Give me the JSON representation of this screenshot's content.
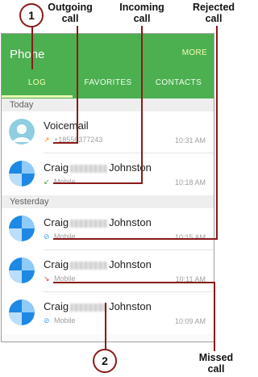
{
  "callouts": {
    "outgoing": "Outgoing\ncall",
    "incoming": "Incoming\ncall",
    "rejected": "Rejected\ncall",
    "missed": "Missed\ncall",
    "step1": "1",
    "step2": "2"
  },
  "appbar": {
    "title": "Phone",
    "more_label": "MORE",
    "tabs": [
      {
        "label": "LOG"
      },
      {
        "label": "FAVORITES"
      },
      {
        "label": "CONTACTS"
      }
    ]
  },
  "colors": {
    "appbar": "#4caf50",
    "callout_line": "#8b1a1a",
    "missed_icon": "#e53935",
    "outgoing_icon": "#ff8a00",
    "incoming_icon": "#43a047",
    "rejected_icon": "#42a5f5"
  },
  "log": {
    "sections": [
      {
        "label": "Today"
      },
      {
        "label": "Yesterday"
      }
    ],
    "entries": [
      {
        "name": "Voicemail",
        "subtitle": "+18556377243",
        "time": "10:31 AM",
        "call_type": "outgoing",
        "icon": "voicemail-avatar-icon"
      },
      {
        "name_first": "Craig",
        "name_last": "Johnston",
        "subtitle": "Mobile",
        "time": "10:18 AM",
        "call_type": "incoming",
        "icon": "contact-avatar-icon"
      },
      {
        "name_first": "Craig",
        "name_last": "Johnston",
        "subtitle": "Mobile",
        "time": "10:15 AM",
        "call_type": "rejected",
        "icon": "contact-avatar-icon"
      },
      {
        "name_first": "Craig",
        "name_last": "Johnston",
        "subtitle": "Mobile",
        "time": "10:11 AM",
        "call_type": "missed",
        "icon": "contact-avatar-icon"
      },
      {
        "name_first": "Craig",
        "name_last": "Johnston",
        "subtitle": "Mobile",
        "time": "10:09 AM",
        "call_type": "rejected",
        "icon": "contact-avatar-icon"
      }
    ]
  }
}
